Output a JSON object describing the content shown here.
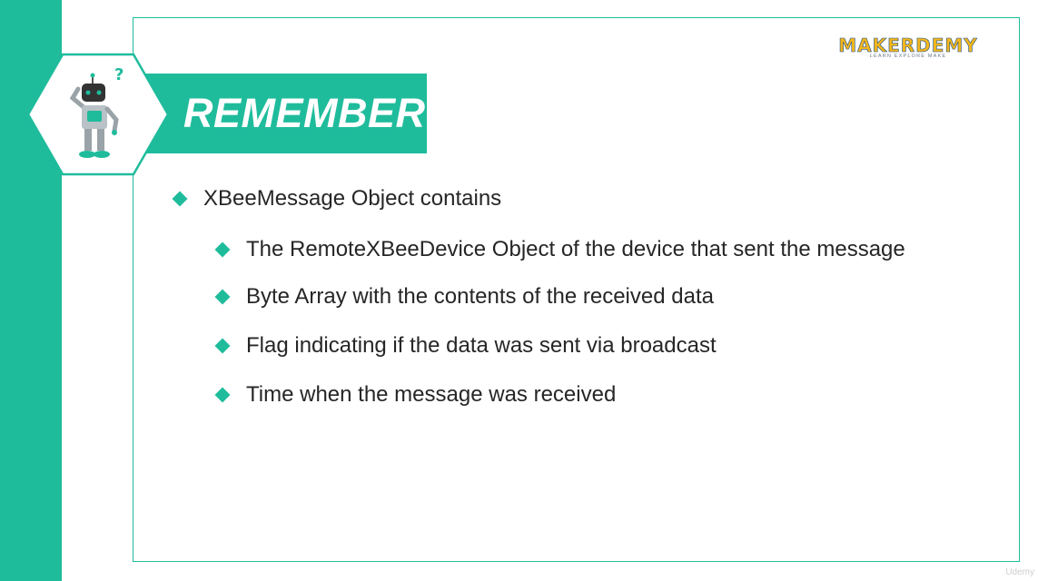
{
  "slide": {
    "heading": "REMEMBER",
    "logo": {
      "word": "MAKERDEMY",
      "tagline": "LEARN EXPLORE MAKE"
    },
    "watermark": "Udemy",
    "bullets": [
      {
        "level": 1,
        "text": "XBeeMessage Object contains"
      },
      {
        "level": 2,
        "text": "The RemoteXBeeDevice Object of the device that sent the message"
      },
      {
        "level": 2,
        "text": "Byte Array with the contents of the received data"
      },
      {
        "level": 2,
        "text": "Flag indicating if the data was sent via broadcast"
      },
      {
        "level": 2,
        "text": "Time when the message was received"
      }
    ]
  },
  "colors": {
    "accent": "#1fbc9c",
    "text": "#262626",
    "logo_yellow": "#f2b61c",
    "logo_blue": "#1a4f8b"
  },
  "icons": {
    "mascot": "robot-mascot-icon",
    "bullet": "diamond-bullet-icon"
  }
}
